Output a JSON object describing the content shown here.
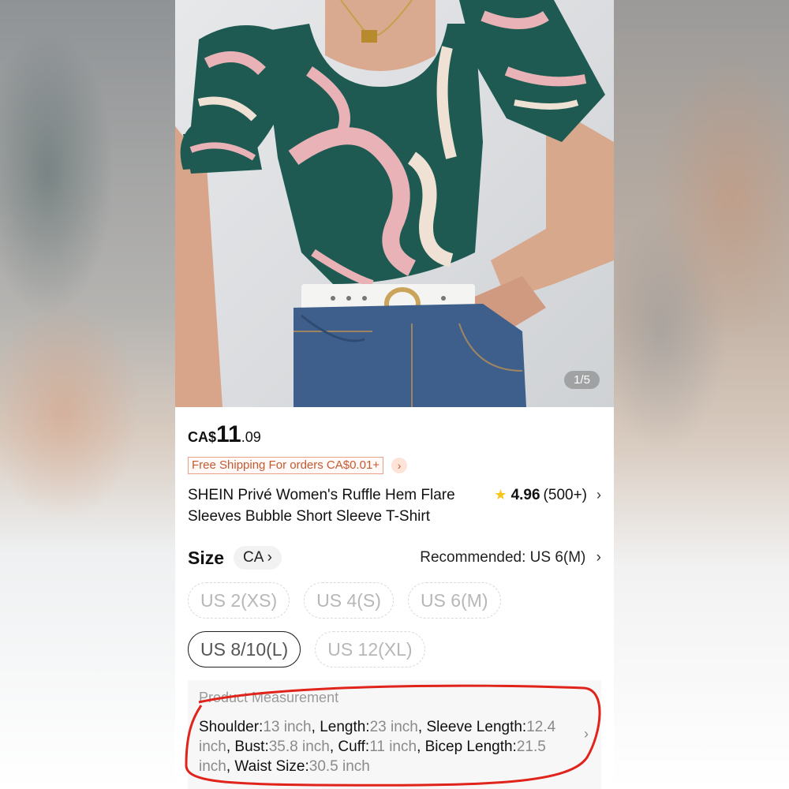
{
  "gallery": {
    "counter": "1/5"
  },
  "price": {
    "currency": "CA$",
    "integer": "11",
    "decimal": ".09"
  },
  "shipping": {
    "tag": "Free Shipping For orders CA$0.01+",
    "arrow": "›"
  },
  "product": {
    "title": "SHEIN Privé Women's Ruffle Hem Flare Sleeves Bubble Short Sleeve T-Shirt",
    "rating": "4.96",
    "reviews": "(500+)"
  },
  "size": {
    "label": "Size",
    "region": "CA",
    "recommended": "Recommended: US 6(M)",
    "options": [
      "US 2(XS)",
      "US 4(S)",
      "US 6(M)",
      "US 8/10(L)",
      "US 12(XL)"
    ],
    "selected": "US 8/10(L)"
  },
  "measurement": {
    "title": "Product Measurement",
    "items": [
      {
        "label": "Shoulder:",
        "value": "13 inch"
      },
      {
        "label": "Length:",
        "value": "23 inch"
      },
      {
        "label": "Sleeve Length:",
        "value": "12.4 inch"
      },
      {
        "label": "Bust:",
        "value": "35.8 inch"
      },
      {
        "label": "Cuff:",
        "value": "11 inch"
      },
      {
        "label": "Bicep Length:",
        "value": "21.5 inch"
      },
      {
        "label": "Waist Size:",
        "value": "30.5 inch"
      }
    ]
  },
  "colors": {
    "shirt_green": "#1e5a52",
    "shirt_pink": "#e9b2b6",
    "denim": "#3e5f8c",
    "annotation_red": "#e0241c"
  }
}
